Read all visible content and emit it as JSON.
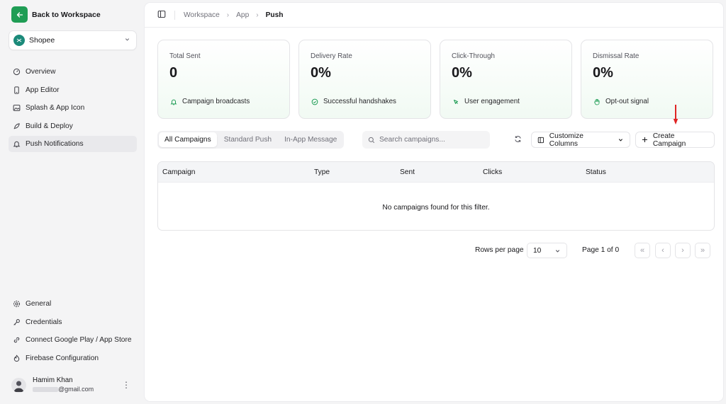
{
  "sidebar": {
    "back_label": "Back to Workspace",
    "app_name": "Shopee",
    "nav_top": [
      {
        "label": "Overview"
      },
      {
        "label": "App Editor"
      },
      {
        "label": "Splash & App Icon"
      },
      {
        "label": "Build & Deploy"
      },
      {
        "label": "Push Notifications"
      }
    ],
    "nav_bottom": [
      {
        "label": "General"
      },
      {
        "label": "Credentials"
      },
      {
        "label": "Connect Google Play / App Store"
      },
      {
        "label": "Firebase Configuration"
      }
    ],
    "user": {
      "name": "Hamim Khan",
      "email_suffix": "@gmail.com"
    }
  },
  "breadcrumb": [
    "Workspace",
    "App",
    "Push"
  ],
  "stats": [
    {
      "label": "Total Sent",
      "value": "0",
      "footer": "Campaign broadcasts",
      "icon": "bell-icon"
    },
    {
      "label": "Delivery Rate",
      "value": "0%",
      "footer": "Successful handshakes",
      "icon": "check-circle-icon"
    },
    {
      "label": "Click-Through",
      "value": "0%",
      "footer": "User engagement",
      "icon": "cursor-click-icon"
    },
    {
      "label": "Dismissal Rate",
      "value": "0%",
      "footer": "Opt-out signal",
      "icon": "hand-icon"
    }
  ],
  "tabs": [
    "All Campaigns",
    "Standard Push",
    "In-App Message"
  ],
  "search": {
    "placeholder": "Search campaigns..."
  },
  "buttons": {
    "customize": "Customize Columns",
    "create": "Create Campaign"
  },
  "table": {
    "columns": [
      "Campaign",
      "Type",
      "Sent",
      "Clicks",
      "Status"
    ],
    "empty_message": "No campaigns found for this filter."
  },
  "pagination": {
    "rows_label": "Rows per page",
    "rows_value": "10",
    "page_label": "Page 1 of 0"
  },
  "colors": {
    "accent": "#1f9d55",
    "annotation_arrow": "#e02424"
  }
}
